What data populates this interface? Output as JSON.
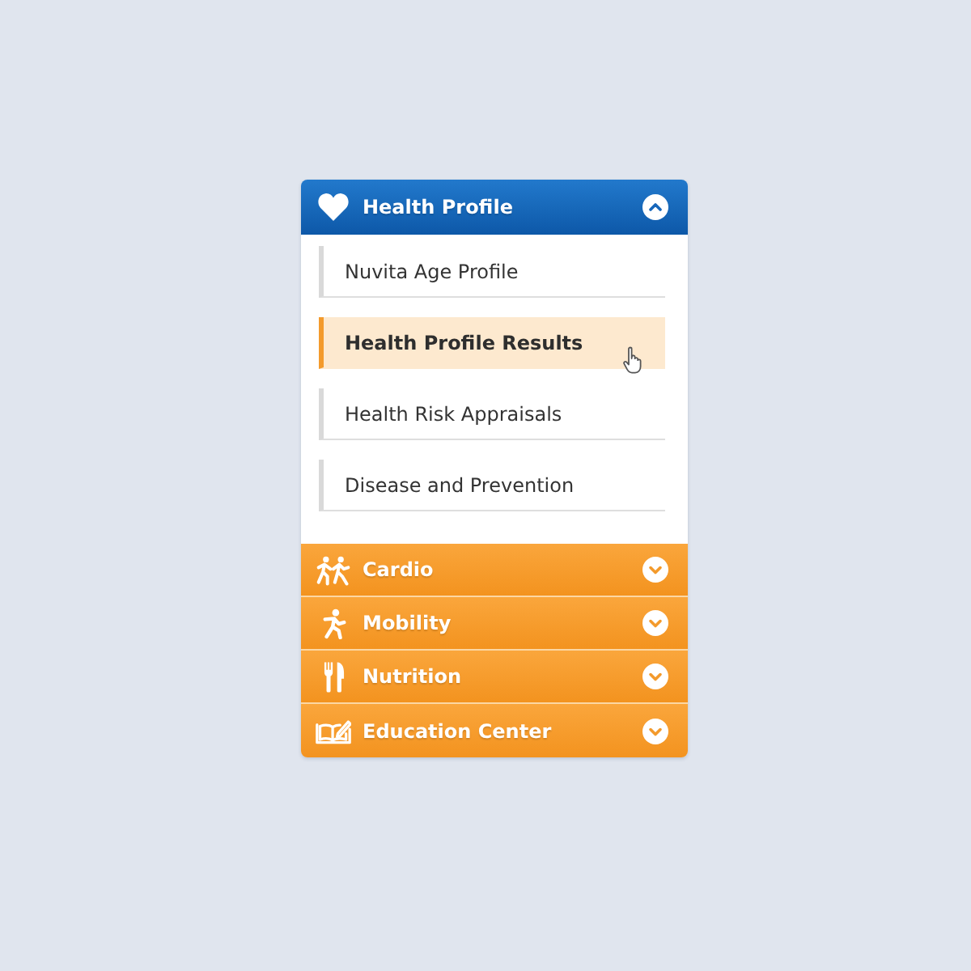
{
  "sections": [
    {
      "title": "Health Profile",
      "expanded": true,
      "items": [
        {
          "label": "Nuvita Age Profile",
          "selected": false
        },
        {
          "label": "Health Profile Results",
          "selected": true
        },
        {
          "label": "Health Risk Appraisals",
          "selected": false
        },
        {
          "label": "Disease and Prevention",
          "selected": false
        }
      ]
    },
    {
      "title": "Cardio",
      "expanded": false
    },
    {
      "title": "Mobility",
      "expanded": false
    },
    {
      "title": "Nutrition",
      "expanded": false
    },
    {
      "title": "Education Center",
      "expanded": false
    }
  ]
}
